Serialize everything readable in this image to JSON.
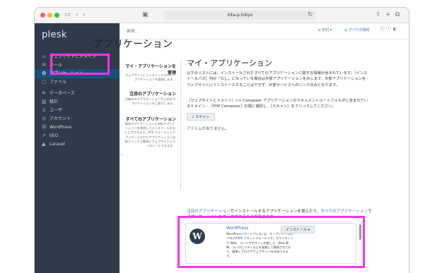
{
  "browser": {
    "url": "kita-p.tokyo"
  },
  "sidebar": {
    "logo": "plesk",
    "items": [
      {
        "label": "ウェブサイトとドメイン",
        "icon": "monitor-icon",
        "glyph": "▭"
      },
      {
        "label": "メール",
        "icon": "mail-icon",
        "glyph": "✉"
      },
      {
        "label": "アプリケーション",
        "icon": "gear-icon",
        "glyph": "⚙"
      },
      {
        "label": "ファイル",
        "icon": "folder-icon",
        "glyph": "▢"
      },
      {
        "label": "データベース",
        "icon": "database-icon",
        "glyph": "≋"
      },
      {
        "label": "統計",
        "icon": "chart-icon",
        "glyph": "▥"
      },
      {
        "label": "ユーザ",
        "icon": "user-icon",
        "glyph": "♙"
      },
      {
        "label": "アカウント",
        "icon": "account-icon",
        "glyph": "◎"
      },
      {
        "label": "WordPress",
        "icon": "wordpress-icon",
        "glyph": "Ⓦ"
      },
      {
        "label": "SEO",
        "icon": "seo-icon",
        "glyph": "↗"
      },
      {
        "label": "Laravel",
        "icon": "laravel-icon",
        "glyph": "▲"
      }
    ]
  },
  "topbar": {
    "search_placeholder": "検索...",
    "user": "中村",
    "subscriptions": "すべての契約"
  },
  "page": {
    "title": "アプリケーション",
    "side_sections": [
      {
        "title": "マイ・アプリケーションを管理",
        "text": "ウェブサイトにインストールされたアプリケーションを管理します。"
      },
      {
        "title": "注目のアプリケーション",
        "text": "お勧めのアプリケーションや人気のアプリケーションをご紹介します。"
      },
      {
        "title": "すべてのアプリケーション",
        "text": "無料アプリケーションと有料アプリケーションを参照してインストールすることができます。APS フォーマットでパッケージされたアプリケーションは新クリックで簡単にウェブサイトにインストールできます。"
      }
    ],
    "heading": "マイ・アプリケーション",
    "para1": "以下のリストには、インストールされたすべてのアプリケーションに関する情報が含まれています。［インストールパス］列が「なし」になっている場合は外部アプリケーションを示します。外部アプリケーションをウェブサイトにインストールすることはできず、外部サービスへのリンクのみとなります。",
    "para2": "［ウェブサイトとドメイン］>> Composer アプリケーションがドキュメントルートフォルダに含まれているドメイン - ［PHP Composer］の順に選択し、［スキャン］をクリックしてください。",
    "scan_button": "スキャン",
    "empty_text": "アイテムがありません。",
    "featured_link": "注目のアプリケーション",
    "featured_text": "でインストールするアプリケーションを選んだり、",
    "all_link": "すべてのアプリケーション",
    "all_text": "でアプリケーションをブラウズすることができます。"
  },
  "wordpress_card": {
    "name": "WordPress",
    "description": "WordPress (ワードプレス) は、オープンソースのブログ/CMS プラットフォームです。セマンティック Web、コードやデザインの美しさ、Web 標準、ユーザビリティなどを意識して開発されており、簡単にブログやウェブサイトを作成できます。",
    "install_button": "インストール",
    "logo_letter": "W"
  },
  "colors": {
    "highlight": "#ff33e6",
    "sidebar": "#2f3a4a",
    "link": "#3a6db5"
  }
}
